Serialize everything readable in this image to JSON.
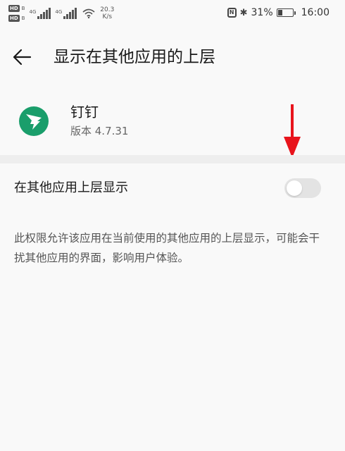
{
  "status_bar": {
    "hd_top": "HD",
    "hd_bottom": "HD",
    "hd_top_suffix": "B",
    "hd_bottom_suffix": "B",
    "net1": "4G",
    "net2": "4G",
    "speed_value": "20.3",
    "speed_unit": "K/s",
    "bluetooth_glyph": "✱",
    "battery": "31%",
    "time": "16:00",
    "battery_level": 0.31
  },
  "header": {
    "title": "显示在其他应用的上层",
    "back_icon": "arrow-left-icon"
  },
  "app": {
    "name": "钉钉",
    "version": "版本 4.7.31",
    "icon": "dingtalk-logo",
    "icon_color": "#1a9e6b"
  },
  "setting": {
    "label": "在其他应用上层显示",
    "enabled": false,
    "description": "此权限允许该应用在当前使用的其他应用的上层显示，可能会干扰其他应用的界面，影响用户体验。"
  },
  "colors": {
    "background": "#f9f9f9",
    "switch_off": "#e3e3e3",
    "annotation_arrow": "#e8141c"
  }
}
